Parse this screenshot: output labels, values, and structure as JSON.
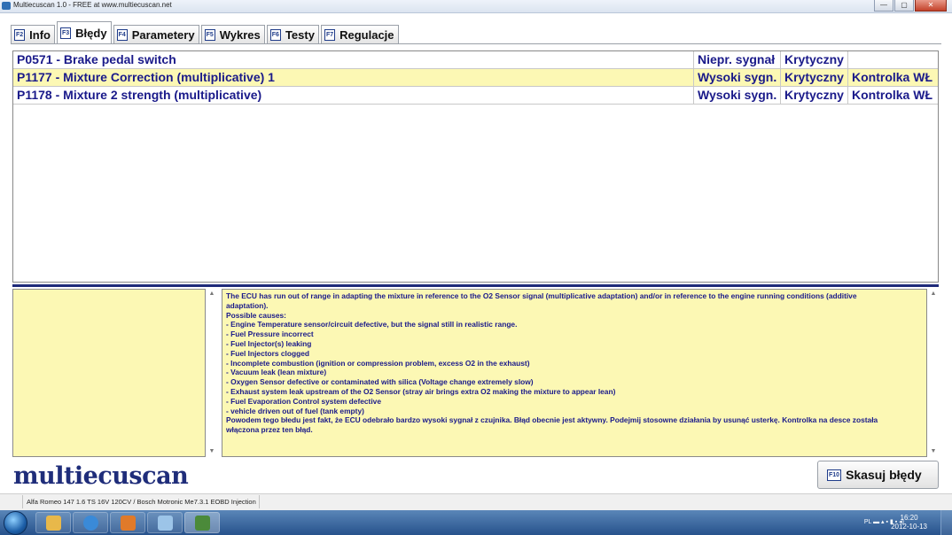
{
  "window": {
    "title": "Multiecuscan 1.0 - FREE at www.multiecuscan.net",
    "buttons": {
      "minimize": "—",
      "maximize": "▢",
      "close": "✕"
    }
  },
  "tabs": [
    {
      "key": "F2",
      "label": "Info"
    },
    {
      "key": "F3",
      "label": "Błędy"
    },
    {
      "key": "F4",
      "label": "Parametery"
    },
    {
      "key": "F5",
      "label": "Wykres"
    },
    {
      "key": "F6",
      "label": "Testy"
    },
    {
      "key": "F7",
      "label": "Regulacje"
    }
  ],
  "active_tab": "F3",
  "fault_codes": [
    {
      "description": "P0571 - Brake pedal switch",
      "signal": "Niepr. sygnał",
      "severity": "Krytyczny",
      "lamp": ""
    },
    {
      "description": "P1177 - Mixture Correction (multiplicative) 1",
      "signal": "Wysoki sygn.",
      "severity": "Krytyczny",
      "lamp": "Kontrolka WŁ"
    },
    {
      "description": "P1178 - Mixture 2 strength  (multiplicative)",
      "signal": "Wysoki sygn.",
      "severity": "Krytyczny",
      "lamp": "Kontrolka WŁ"
    }
  ],
  "selected_row": 1,
  "description_lines": [
    "The ECU has run out of range in adapting the mixture in reference to the O2 Sensor signal (multiplicative adaptation) and/or in reference to the engine running conditions (additive",
    "adaptation).",
    "Possible causes:",
    "- Engine Temperature sensor/circuit defective, but the signal still in realistic range.",
    "- Fuel Pressure incorrect",
    "- Fuel Injector(s) leaking",
    "- Fuel Injectors clogged",
    "- Incomplete combustion (ignition or compression problem, excess O2 in the exhaust)",
    "- Vacuum leak (lean mixture)",
    "- Oxygen Sensor defective or contaminated with silica (Voltage change extremely slow)",
    "- Exhaust system leak upstream of the O2 Sensor (stray air brings extra O2 making the mixture to appear lean)",
    "- Fuel Evaporation Control system defective",
    "- vehicle driven out of fuel (tank empty)",
    "Powodem tego błedu jest fakt, że ECU odebrało bardzo wysoki sygnał z czujnika. Błąd obecnie jest aktywny. Podejmij stosowne działania by usunąć usterkę. Kontrolka na desce została",
    "włączona przez ten błąd."
  ],
  "logo_text": "multiecuscan",
  "clear_button": {
    "key": "F10",
    "label": "Skasuj błędy"
  },
  "status_bar": {
    "vehicle": "Alfa Romeo 147 1.6 TS 16V 120CV / Bosch Motronic Me7.3.1 EOBD Injection"
  },
  "taskbar": {
    "language": "PL",
    "time": "16:20",
    "date": "2012-10-13"
  },
  "colors": {
    "selected_row_bg": "#fcf8b4",
    "code_text": "#1a1a8a",
    "separator": "#1f2a7a",
    "logo": "#1f2d7a"
  }
}
